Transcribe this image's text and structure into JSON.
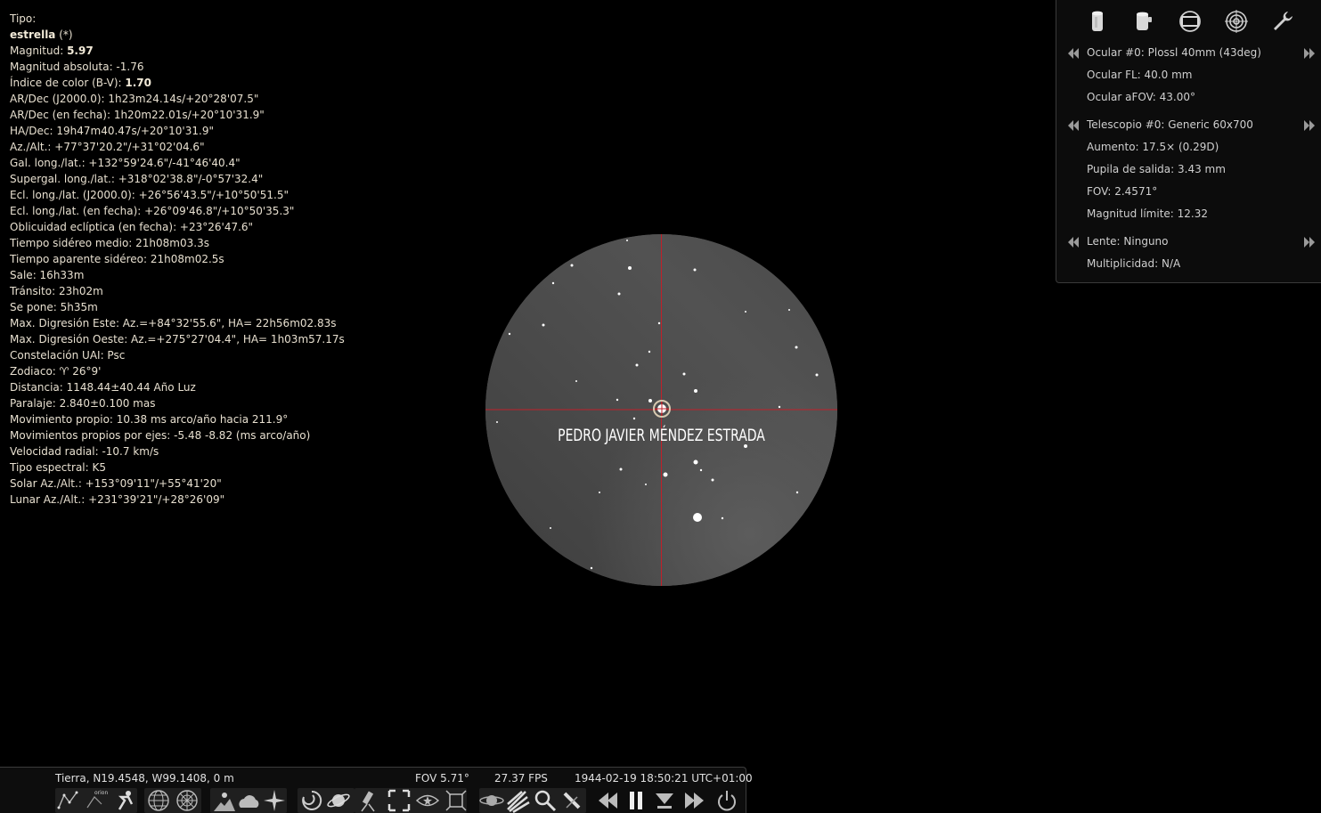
{
  "info": {
    "tipo_label": "Tipo:",
    "tipo_value": "estrella",
    "tipo_suffix": "(*)",
    "magnitud_label": "Magnitud:",
    "magnitud_value": "5.97",
    "lines_a": [
      "Magnitud absoluta: -1.76"
    ],
    "color_label": "Índice de color (B-V):",
    "color_value": "1.70",
    "lines_b": [
      "AR/Dec (J2000.0): 1h23m24.14s/+20°28'07.5\"",
      "AR/Dec (en fecha): 1h20m22.01s/+20°10'31.9\"",
      "HA/Dec: 19h47m40.47s/+20°10'31.9\"",
      "Az./Alt.: +77°37'20.2\"/+31°02'04.6\"",
      "Gal. long./lat.: +132°59'24.6\"/-41°46'40.4\"",
      "Supergal. long./lat.: +318°02'38.8\"/-0°57'32.4\"",
      "Ecl. long./lat. (J2000.0): +26°56'43.5\"/+10°50'51.5\"",
      "Ecl. long./lat. (en fecha): +26°09'46.8\"/+10°50'35.3\"",
      "Oblicuidad eclíptica (en fecha): +23°26'47.6\"",
      "Tiempo sidéreo medio: 21h08m03.3s",
      "Tiempo aparente sidéreo: 21h08m02.5s",
      "Sale: 16h33m",
      "Tránsito: 23h02m",
      "Se pone: 5h35m",
      "Max. Digresión Este: Az.=+84°32'55.6\", HA= 22h56m02.83s",
      "Max. Digresión Oeste: Az.=+275°27'04.4\", HA= 1h03m57.17s",
      "Constelación UAI: Psc",
      "Zodiaco: ♈ 26°9'",
      "Distancia: 1148.44±40.44 Año Luz",
      "Paralaje: 2.840±0.100 mas",
      "Movimiento propio: 10.38 ms arco/año hacia 211.9°",
      "Movimientos propios por ejes: -5.48 -8.82 (ms arco/año)",
      "Velocidad radial: -10.7 km/s",
      "Tipo espectral: K5",
      "Solar Az./Alt.: +153°09'11\"/+55°41'20\"",
      "Lunar Az./Alt.: +231°39'21\"/+28°26'09\""
    ]
  },
  "oculars": {
    "tools": [
      "eyepiece-icon",
      "telescope-icon",
      "sensor-frame-icon",
      "target-icon",
      "wrench-icon"
    ],
    "ocular_title": "Ocular #0: Plossl 40mm (43deg)",
    "ocular_fl": "Ocular FL: 40.0 mm",
    "ocular_afov": "Ocular aFOV: 43.00°",
    "telescope_title": "Telescopio #0: Generic 60x700",
    "aumento": "Aumento: 17.5× (0.29D)",
    "pupila": "Pupila de salida: 3.43 mm",
    "fov": "FOV: 2.4571°",
    "magnitud_limite": "Magnitud límite: 12.32",
    "lente_title": "Lente: Ninguno",
    "multiplicidad": "Multiplicidad: N/A"
  },
  "view": {
    "watermark": "PEDRO JAVIER MÉNDEZ ESTRADA",
    "crosshair_color": "#c0202a"
  },
  "status": {
    "location": "Tierra, N19.4548, W99.1408, 0 m",
    "fov": "FOV 5.71°",
    "fps": "27.37 FPS",
    "datetime": "1944-02-19 18:50:21 UTC+01:00"
  }
}
